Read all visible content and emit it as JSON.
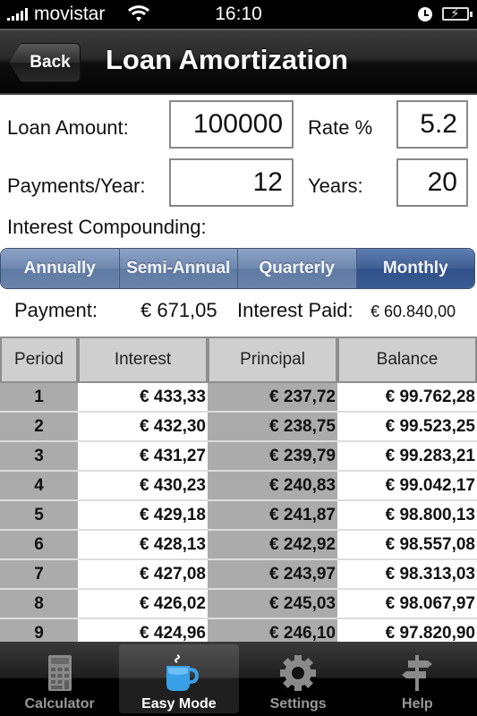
{
  "status_bar": {
    "carrier": "movistar",
    "time": "16:10",
    "icons": [
      "signal-icon",
      "wifi-icon",
      "alarm-clock-icon",
      "battery-charging-icon"
    ]
  },
  "nav": {
    "back_label": "Back",
    "title": "Loan Amortization"
  },
  "form": {
    "loan_amount_label": "Loan Amount:",
    "loan_amount_value": "100000",
    "rate_label": "Rate %",
    "rate_value": "5.2",
    "payments_label": "Payments/Year:",
    "payments_value": "12",
    "years_label": "Years:",
    "years_value": "20",
    "compounding_label": "Interest Compounding:"
  },
  "compounding": {
    "options": [
      "Annually",
      "Semi-Annual",
      "Quarterly",
      "Monthly"
    ],
    "selected": "Monthly"
  },
  "summary": {
    "payment_label": "Payment:",
    "payment_value": "€ 671,05",
    "interest_label": "Interest Paid:",
    "interest_value": "€ 60.840,00"
  },
  "table": {
    "headers": [
      "Period",
      "Interest",
      "Principal",
      "Balance"
    ],
    "rows": [
      [
        "1",
        "€ 433,33",
        "€ 237,72",
        "€ 99.762,28"
      ],
      [
        "2",
        "€ 432,30",
        "€ 238,75",
        "€ 99.523,25"
      ],
      [
        "3",
        "€ 431,27",
        "€ 239,79",
        "€ 99.283,21"
      ],
      [
        "4",
        "€ 430,23",
        "€ 240,83",
        "€ 99.042,17"
      ],
      [
        "5",
        "€ 429,18",
        "€ 241,87",
        "€ 98.800,13"
      ],
      [
        "6",
        "€ 428,13",
        "€ 242,92",
        "€ 98.557,08"
      ],
      [
        "7",
        "€ 427,08",
        "€ 243,97",
        "€ 98.313,03"
      ],
      [
        "8",
        "€ 426,02",
        "€ 245,03",
        "€ 98.067,97"
      ],
      [
        "9",
        "€ 424,96",
        "€ 246,10",
        "€ 97.820,90"
      ]
    ]
  },
  "tab_bar": {
    "tabs": [
      {
        "label": "Calculator",
        "icon": "calculator-icon"
      },
      {
        "label": "Easy Mode",
        "icon": "coffee-cup-icon"
      },
      {
        "label": "Settings",
        "icon": "gear-icon"
      },
      {
        "label": "Help",
        "icon": "signpost-icon"
      }
    ],
    "selected": "Easy Mode"
  },
  "colors": {
    "segment_accent": "#6e87ad",
    "segment_selected": "#3f5f94",
    "easy_mode_icon": "#3aa0e8"
  }
}
